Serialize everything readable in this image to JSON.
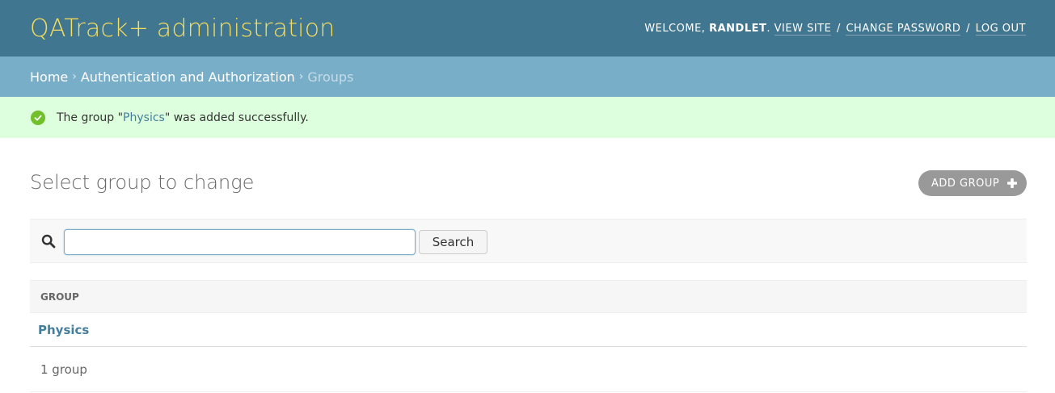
{
  "header": {
    "branding": "QATrack+ administration",
    "welcome": "WELCOME,",
    "username": "RANDLET",
    "after_username": ".",
    "view_site": "VIEW SITE",
    "change_password": "CHANGE PASSWORD",
    "log_out": "LOG OUT",
    "separator": "/"
  },
  "breadcrumbs": {
    "home": "Home",
    "app": "Authentication and Authorization",
    "current": "Groups",
    "separator": "›"
  },
  "message": {
    "prefix": "The group \"",
    "link": "Physics",
    "suffix": "\" was added successfully."
  },
  "page": {
    "title": "Select group to change",
    "add_button": "ADD GROUP"
  },
  "search": {
    "value": "",
    "button_label": "Search"
  },
  "table": {
    "column_header": "GROUP",
    "rows": [
      {
        "name": "Physics"
      }
    ]
  },
  "paginator": {
    "count_text": "1 group"
  },
  "colors": {
    "header_bg": "#417690",
    "branding": "#f5dd5d",
    "breadcrumbs_bg": "#79aec8",
    "success_bg": "#ddffdd",
    "success_icon": "#70bf2b",
    "link": "#447e9b"
  },
  "icons": {
    "message": "success-check-icon",
    "add": "plus-icon",
    "search": "search-icon"
  }
}
